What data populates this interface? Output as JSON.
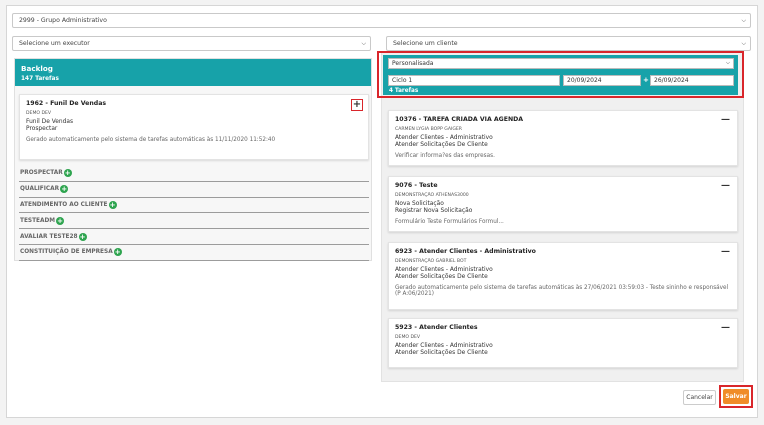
{
  "filters": {
    "group": "2999 - Grupo Administrativo",
    "executor_placeholder": "Selecione um executor",
    "client_placeholder": "Selecione um cliente"
  },
  "backlog": {
    "title": "Backlog",
    "count": "147 Tarefas",
    "card": {
      "title": "1962 - Funil De Vendas",
      "client": "DEMO DEV",
      "line1": "Funil De Vendas",
      "line2": "Prospectar",
      "note": "Gerado automaticamente pelo sistema de tarefas automáticas às 11/11/2020 11:52:40",
      "add": "+"
    },
    "stages": [
      {
        "label": "PROSPECTAR"
      },
      {
        "label": "QUALIFICAR"
      },
      {
        "label": "ATENDIMENTO AO CLIENTE"
      },
      {
        "label": "TESTEADM"
      },
      {
        "label": "AVALIAR TESTE28"
      },
      {
        "label": "CONSTITUIÇÃO DE EMPRESA"
      }
    ]
  },
  "cycle": {
    "period": "Personalisada",
    "cycle_name": "Ciclo 1",
    "date_start": "20/09/2024",
    "date_sep": "+",
    "date_end": "26/09/2024",
    "count": "4 Tarefas"
  },
  "tasks": [
    {
      "title": "10376 - TAREFA CRIADA VIA AGENDA",
      "client": "CARMEN LYGIA BOPP GAIGER",
      "line1": "Atender Clientes - Administrativo",
      "line2": "Atender Solicitações De Cliente",
      "note": "Verificar informa?es das empresas."
    },
    {
      "title": "9076 - Teste",
      "client": "DEMONSTRAÇÃO ATHENAS3000",
      "line1": "Nova Solicitação",
      "line2": "Registrar Nova Solicitação",
      "note": "Formulário Teste Formulários Formul..."
    },
    {
      "title": "6923 - Atender Clientes - Administrativo",
      "client": "DEMONSTRAÇÃO GABRIEL BOT",
      "line1": "Atender Clientes - Administrativo",
      "line2": "Atender Solicitações De Cliente",
      "note": "Gerado automaticamente pelo sistema de tarefas automáticas às 27/06/2021 03:59:03 - Teste sininho e responsável (P A:06/2021)"
    },
    {
      "title": "5923 - Atender Clientes",
      "client": "DEMO DEV",
      "line1": "Atender Clientes - Administrativo",
      "line2": "Atender Solicitações De Cliente",
      "note": ""
    }
  ],
  "footer": {
    "cancel": "Cancelar",
    "save": "Salvar"
  },
  "colors": {
    "teal": "#17a2a9",
    "highlight": "#d9262b",
    "save": "#f08c28",
    "stage_plus": "#2ea44f"
  }
}
